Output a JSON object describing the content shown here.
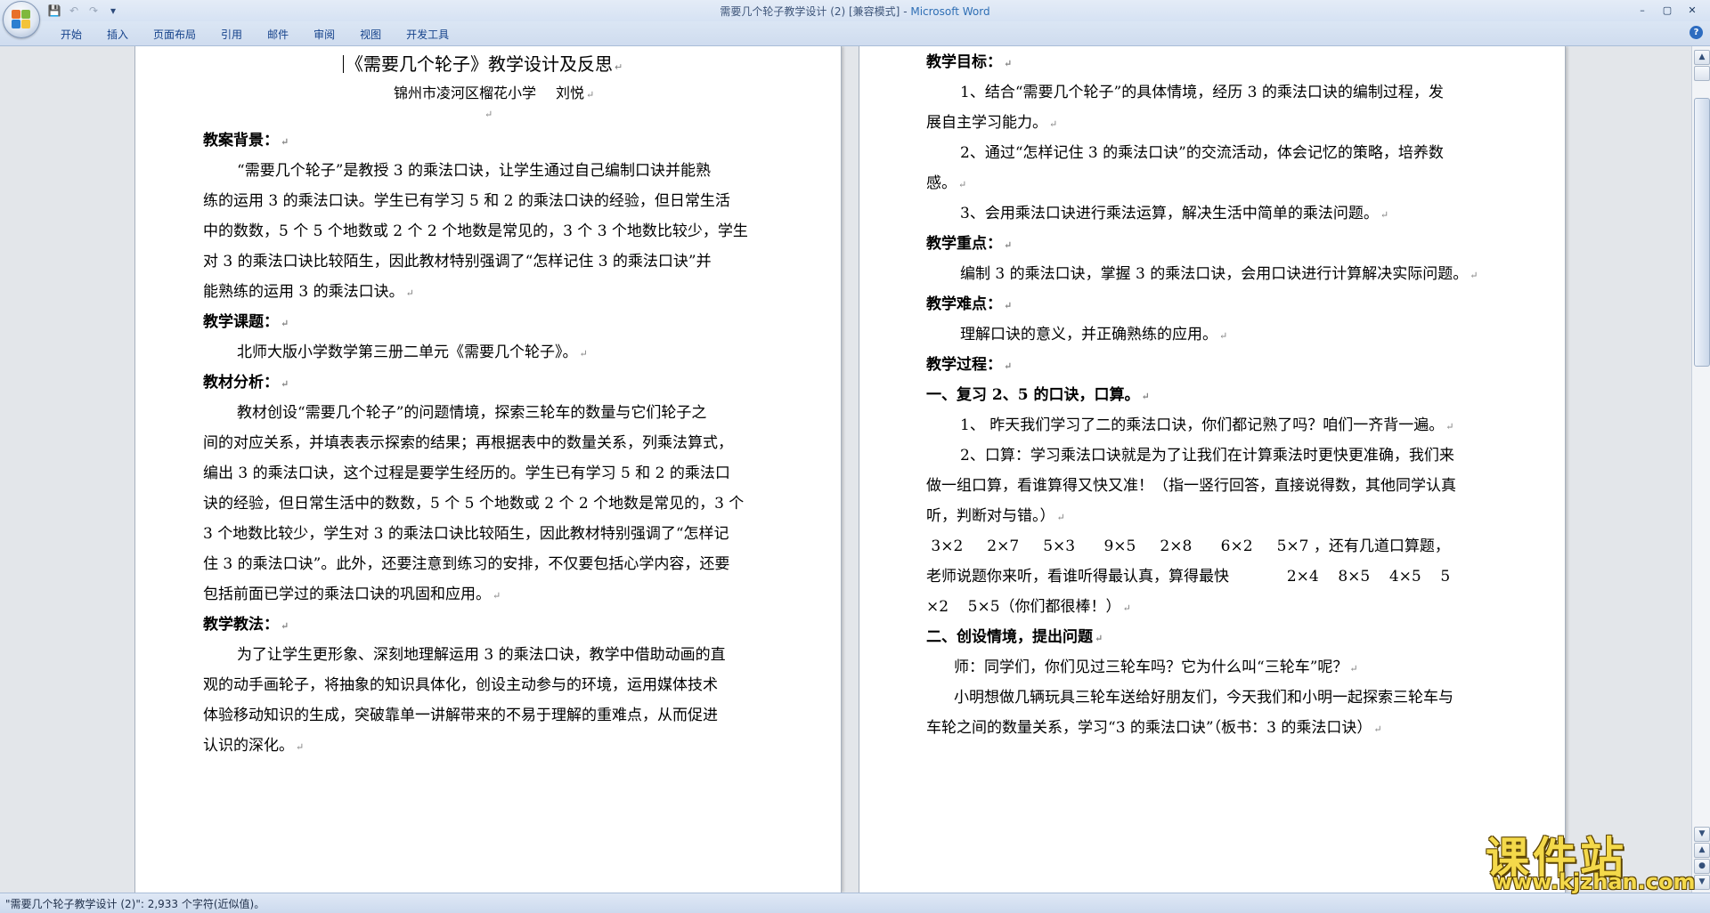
{
  "window": {
    "title": "需要几个轮子教学设计 (2) [兼容模式]",
    "app_name": "Microsoft Word",
    "title_sep": " - "
  },
  "quick_access": {
    "icons": [
      "save-icon",
      "undo-icon",
      "redo-icon",
      "customize-icon"
    ],
    "glyphs": {
      "save": "💾",
      "undo": "↶",
      "redo": "↷",
      "more": "▾"
    }
  },
  "window_controls": {
    "minimize": "–",
    "maximize": "▢",
    "close": "✕"
  },
  "ribbon": {
    "tabs": [
      "开始",
      "插入",
      "页面布局",
      "引用",
      "邮件",
      "审阅",
      "视图",
      "开发工具"
    ],
    "help": "?"
  },
  "marks": {
    "para": "↵"
  },
  "left_page": {
    "title": "《需要几个轮子》教学设计及反思",
    "author_school": "锦州市凌河区榴花小学",
    "author_name": "刘悦",
    "h_background": "教案背景：",
    "p1": [
      "“需要几个轮子”是教授 3 的乘法口诀，让学生通过自己编制口诀并能熟",
      "练的运用 3 的乘法口诀。学生已有学习 5 和 2 的乘法口诀的经验，但日常生活",
      "中的数数，5 个 5 个地数或 2 个 2 个地数是常见的，3 个 3 个地数比较少，学生",
      "对 3 的乘法口诀比较陌生，因此教材特别强调了“怎样记住 3 的乘法口诀”并",
      "能熟练的运用 3 的乘法口诀。"
    ],
    "h_topic": "教学课题：",
    "topic": "北师大版小学数学第三册二单元《需要几个轮子》。",
    "h_analysis": "教材分析：",
    "p2": [
      "教材创设“需要几个轮子”的问题情境，探索三轮车的数量与它们轮子之",
      "间的对应关系，并填表表示探索的结果；再根据表中的数量关系，列乘法算式，",
      "编出 3 的乘法口诀，这个过程是要学生经历的。学生已有学习 5 和 2 的乘法口",
      "诀的经验，但日常生活中的数数，5 个 5 个地数或 2 个 2 个地数是常见的，3 个",
      "3 个地数比较少，学生对 3 的乘法口诀比较陌生，因此教材特别强调了“怎样记",
      "住 3 的乘法口诀”。此外，还要注意到练习的安排，不仅要包括心学内容，还要",
      "包括前面已学过的乘法口诀的巩固和应用。"
    ],
    "h_method": "教学教法：",
    "p3": [
      "为了让学生更形象、深刻地理解运用 3 的乘法口诀，教学中借助动画的直",
      "观的动手画轮子，将抽象的知识具体化，创设主动参与的环境，运用媒体技术",
      "体验移动知识的生成，突破靠单一讲解带来的不易于理解的重难点，从而促进",
      "认识的深化。"
    ]
  },
  "right_page": {
    "h_goal": "教学目标：",
    "goal1": [
      "1、结合“需要几个轮子”的具体情境，经历 3 的乘法口诀的编制过程，发",
      "展自主学习能力。"
    ],
    "goal2": [
      "2、通过“怎样记住 3 的乘法口诀”的交流活动，体会记忆的策略，培养数",
      "感。"
    ],
    "goal3": "3、会用乘法口诀进行乘法运算，解决生活中简单的乘法问题。",
    "h_key": "教学重点：",
    "key": "编制 3 的乘法口诀，掌握 3 的乘法口诀，会用口诀进行计算解决实际问题。",
    "h_difficulty": "教学难点：",
    "difficulty": "理解口诀的意义，并正确熟练的应用。",
    "h_process": "教学过程：",
    "s1": "一、复习 2、5 的口诀，口算。",
    "s1_1": "1、  昨天我们学习了二的乘法口诀，你们都记熟了吗？咱们一齐背一遍。",
    "s1_2": [
      "2、口算：学习乘法口诀就是为了让我们在计算乘法时更快更准确，我们来",
      "做一组口算，看谁算得又快又准！（指一竖行回答，直接说得数，其他同学认真",
      "听，判断对与错。）"
    ],
    "calc": [
      " 3×2     2×7     5×3      9×5     2×8      6×2     5×7 ，还有几道口算题，",
      "老师说题你来听，看谁听得最认真，算得最快            2×4    8×5    4×5    5",
      "×2    5×5（你们都很棒！）"
    ],
    "s2": "二、创设情境，提出问题",
    "t1": "师：同学们，你们见过三轮车吗？它为什么叫“三轮车”呢？",
    "t2": [
      "小明想做几辆玩具三轮车送给好朋友们，今天我们和小明一起探索三轮车与",
      "车轮之间的数量关系，学习“3 的乘法口诀”（板书：3 的乘法口诀）"
    ]
  },
  "status": {
    "text": "\"需要几个轮子教学设计 (2)\": 2,933 个字符(近似值)。"
  },
  "scrollbar": {
    "up": "▲",
    "down": "▼",
    "prev_page": "▲",
    "select_browse": "●",
    "next_page": "▼"
  },
  "watermark": {
    "cn": "课件站",
    "url": "www.kjzhan.com"
  },
  "colors": {
    "accent": "#2f6fb5",
    "tab_text": "#15428b",
    "watermark": "#f4d94a"
  }
}
